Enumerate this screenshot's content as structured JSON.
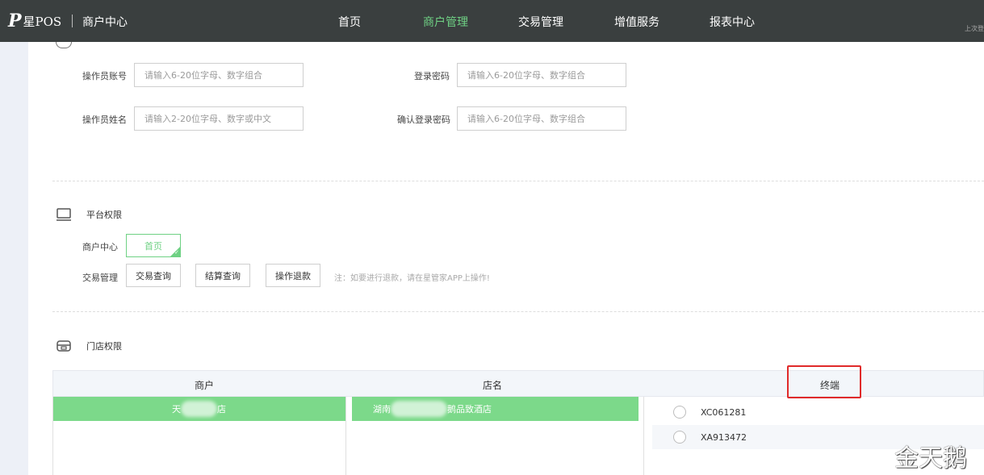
{
  "header": {
    "logo_mark": "P",
    "logo_text": "星POS",
    "portal_name": "商户中心",
    "nav": [
      {
        "label": "首页",
        "active": false
      },
      {
        "label": "商户管理",
        "active": true
      },
      {
        "label": "交易管理",
        "active": false
      },
      {
        "label": "增值服务",
        "active": false
      },
      {
        "label": "报表中心",
        "active": false
      }
    ],
    "top_right": "上次登",
    "accent_color": "#6fd184",
    "bg_color": "#3a3f3f"
  },
  "form": {
    "account_label": "操作员账号",
    "account_placeholder": "请输入6-20位字母、数字组合",
    "password_label": "登录密码",
    "password_placeholder": "请输入6-20位字母、数字组合",
    "name_label": "操作员姓名",
    "name_placeholder": "请输入2-20位字母、数字或中文",
    "confirm_label": "确认登录密码",
    "confirm_placeholder": "请输入6-20位字母、数字组合"
  },
  "platform": {
    "title": "平台权限",
    "merchant_center_label": "商户中心",
    "home_button": "首页",
    "trade_label": "交易管理",
    "trade_query": "交易查询",
    "settle_query": "结算查询",
    "refund": "操作退款",
    "note": "注：如要进行退款，请在星管家APP上操作!"
  },
  "store": {
    "title": "门店权限",
    "columns": [
      "商户",
      "店名",
      "终端"
    ],
    "merchant_selected_prefix": "天",
    "merchant_selected_suffix": "店",
    "store_selected_prefix": "湖南",
    "store_selected_suffix": "鹅品致酒店",
    "terminals": [
      "XC061281",
      "XA913472"
    ]
  },
  "watermark": "金天鹅"
}
